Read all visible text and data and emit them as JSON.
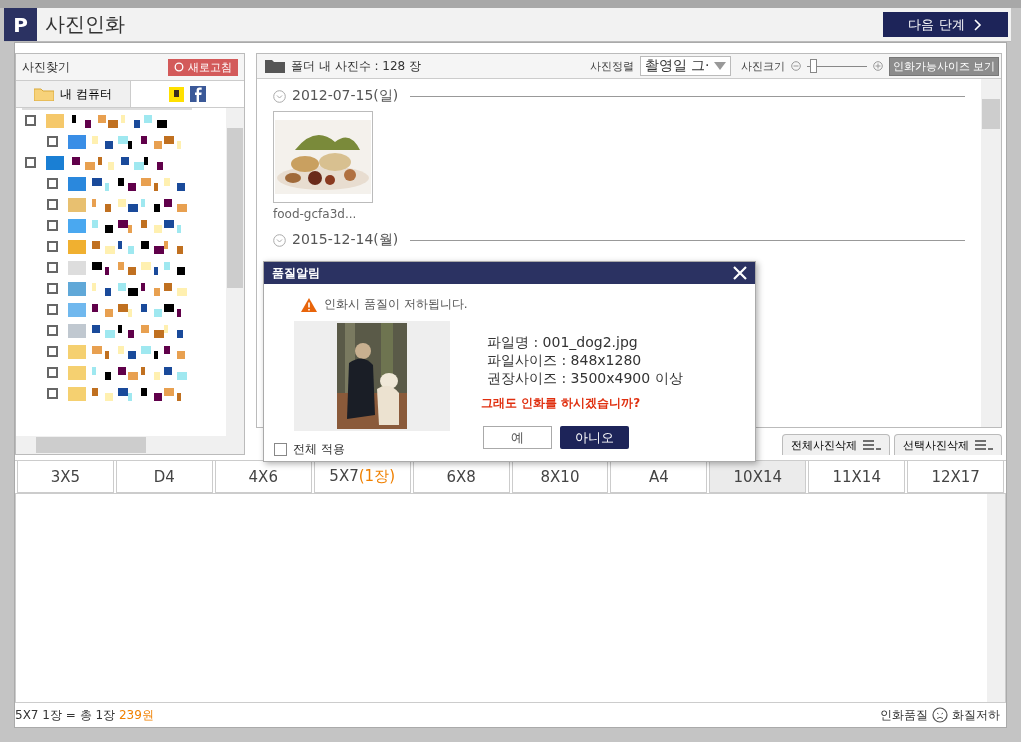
{
  "window": {
    "logo": "P",
    "title": "사진인화",
    "next_button": "다음 단계"
  },
  "finder": {
    "title": "사진찾기",
    "refresh_button": "새로고침",
    "tabs": [
      {
        "label": "내 컴퓨터",
        "selected": true,
        "kind": "computer"
      },
      {
        "selected": false,
        "kind": "social"
      }
    ]
  },
  "photos": {
    "folder_count": "폴더 내 사진수 : 128 장",
    "sort_label": "사진정렬",
    "sort_value": "촬영일 그·",
    "size_label": "사진크기",
    "size_slider": {
      "level": 0.1
    },
    "view_sizes_button": "인화가능사이즈 보기",
    "groups": [
      {
        "date": "2012-07-15(일)",
        "photos": [
          {
            "name": "food-gcfa3d..."
          }
        ]
      },
      {
        "date": "2015-12-14(월)"
      }
    ]
  },
  "delete_buttons": [
    "전체사진삭제",
    "선택사진삭제"
  ],
  "size_tabs": [
    {
      "label": "3X5",
      "selected": false
    },
    {
      "label": "D4",
      "selected": false
    },
    {
      "label": "4X6",
      "selected": false
    },
    {
      "label": "5X7",
      "count": "(1장)",
      "selected": false
    },
    {
      "label": "6X8",
      "selected": false
    },
    {
      "label": "8X10",
      "selected": false
    },
    {
      "label": "A4",
      "selected": false
    },
    {
      "label": "10X14",
      "selected": true
    },
    {
      "label": "11X14",
      "selected": false
    },
    {
      "label": "12X17",
      "selected": false
    }
  ],
  "footer": {
    "summary": "5X7 1장 = 총 1장",
    "price": "239원",
    "quality_label": "인화품질",
    "quality_value": "화질저하"
  },
  "dialog": {
    "title": "품질알림",
    "warning": "인화시 품질이 저하됩니다.",
    "info": [
      "파일명 : 001_dog2.jpg",
      "파일사이즈 : 848x1280",
      "권장사이즈 : 3500x4900 이상"
    ],
    "question": "그래도 인화를 하시겠습니까?",
    "yes_button": "예",
    "no_button": "아니오",
    "apply_all": {
      "label": "전체 적용",
      "checked": false
    }
  }
}
